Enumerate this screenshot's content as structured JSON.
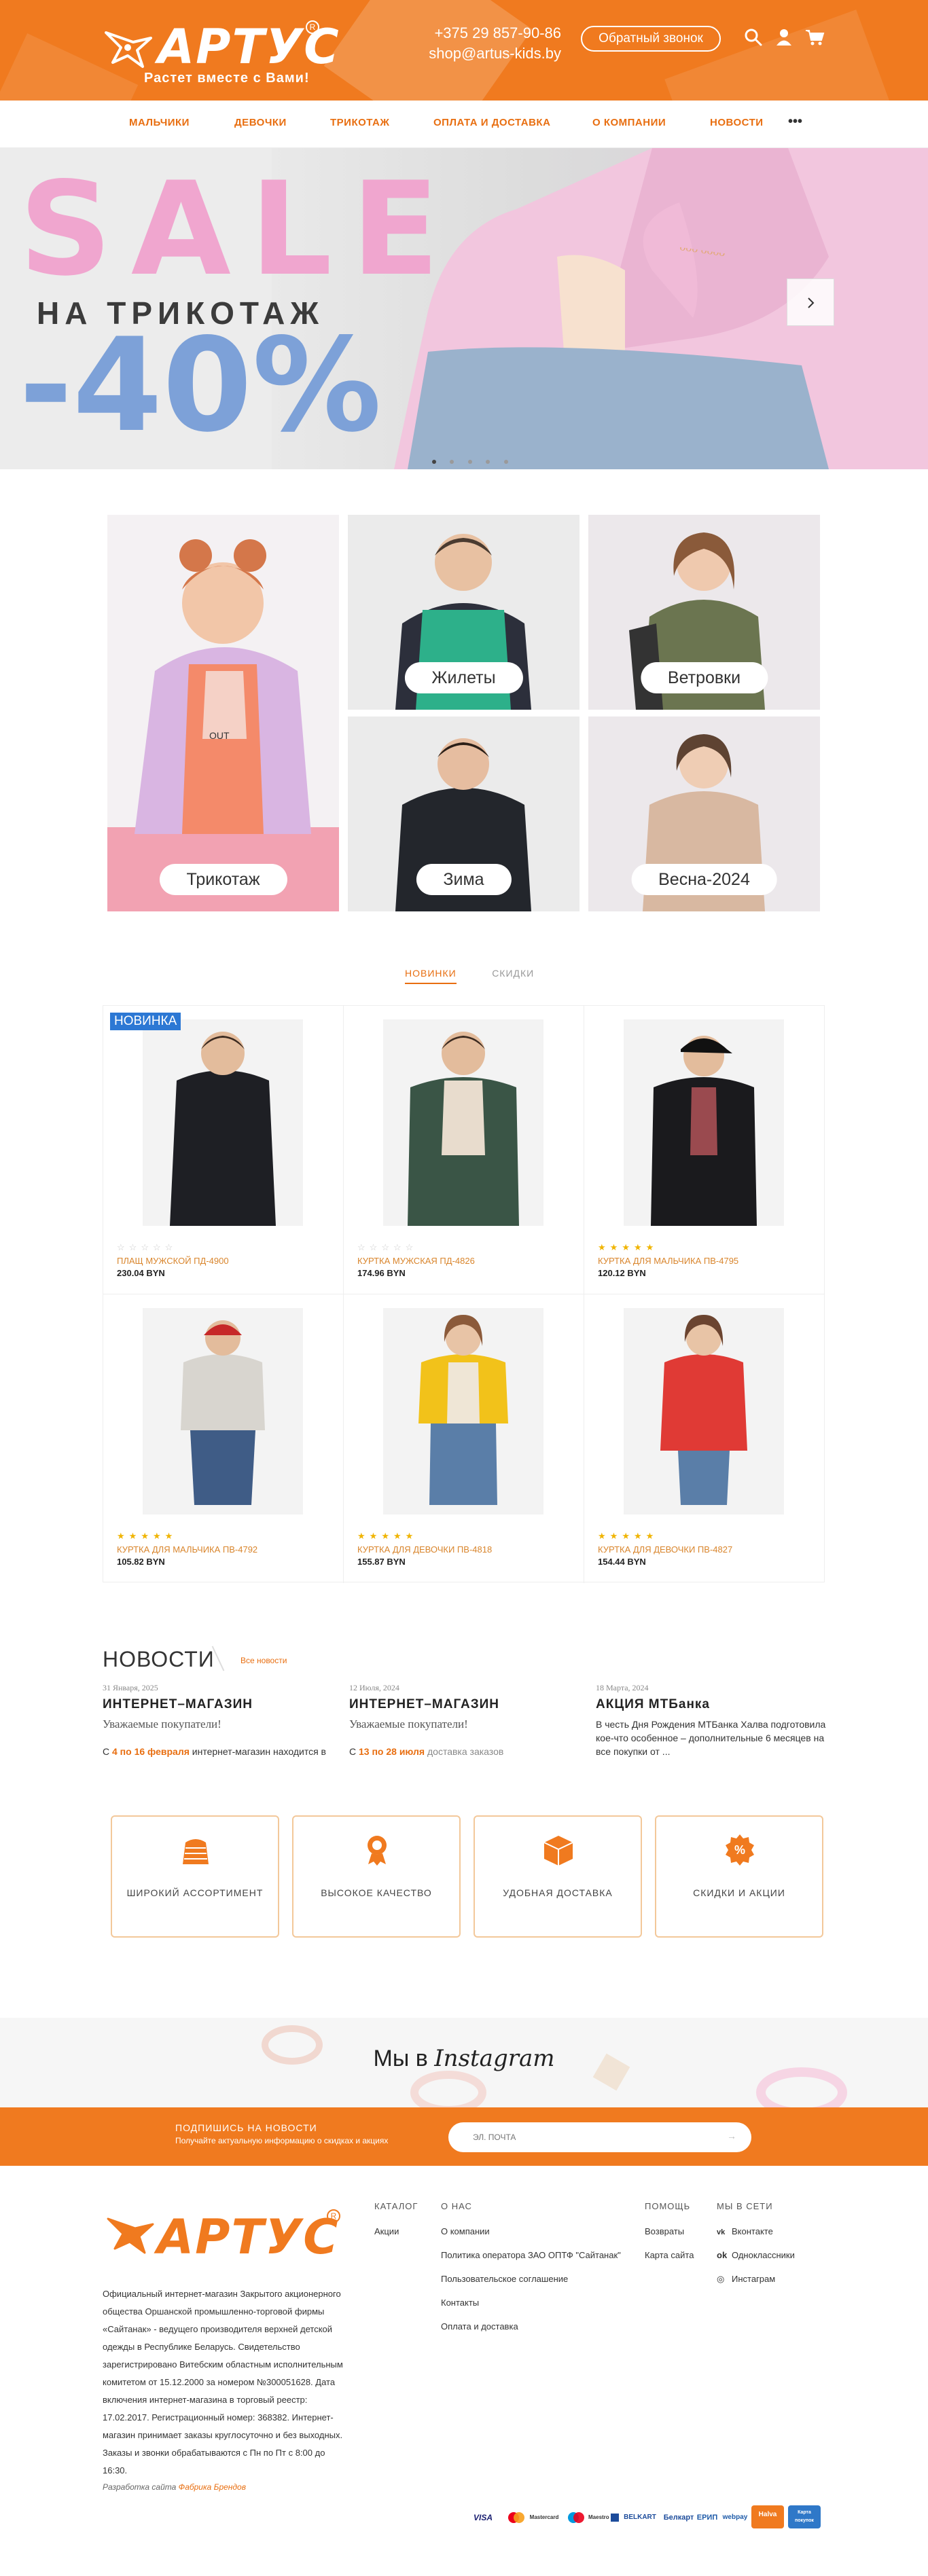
{
  "header": {
    "logo_text": "АРТУС",
    "logo_reg": "R",
    "slogan": "Растет вместе с Вами!",
    "phone": "+375 29 857-90-86",
    "email": "shop@artus-kids.by",
    "callback_label": "Обратный звонок"
  },
  "nav": {
    "items": [
      "МАЛЬЧИКИ",
      "ДЕВОЧКИ",
      "ТРИКОТАЖ",
      "ОПЛАТА И ДОСТАВКА",
      "О КОМПАНИИ",
      "НОВОСТИ"
    ],
    "more": "•••"
  },
  "hero": {
    "sale": "SALE",
    "subtitle": "НА ТРИКОТАЖ",
    "discount": "-40%",
    "slide_count": 5,
    "active_slide": 1
  },
  "categories": [
    {
      "label": "Трикотаж"
    },
    {
      "label": "Жилеты"
    },
    {
      "label": "Ветровки"
    },
    {
      "label": "Зима"
    },
    {
      "label": "Весна-2024"
    }
  ],
  "tabs": {
    "new": "НОВИНКИ",
    "sale": "СКИДКИ"
  },
  "products": [
    {
      "name": "ПЛАЩ МУЖСКОЙ ПД-4900",
      "price": "230.04 BYN",
      "badge": "НОВИНКА",
      "rating": 0
    },
    {
      "name": "КУРТКА МУЖСКАЯ ПД-4826",
      "price": "174.96 BYN",
      "badge": "",
      "rating": 0
    },
    {
      "name": "КУРТКА ДЛЯ МАЛЬЧИКА ПВ-4795",
      "price": "120.12 BYN",
      "badge": "",
      "rating": 5
    },
    {
      "name": "КУРТКА ДЛЯ МАЛЬЧИКА ПВ-4792",
      "price": "105.82 BYN",
      "badge": "",
      "rating": 5
    },
    {
      "name": "КУРТКА ДЛЯ ДЕВОЧКИ ПВ-4818",
      "price": "155.87 BYN",
      "badge": "",
      "rating": 5
    },
    {
      "name": "КУРТКА ДЛЯ ДЕВОЧКИ ПВ-4827",
      "price": "154.44 BYN",
      "badge": "",
      "rating": 5
    }
  ],
  "news": {
    "title": "НОВОСТИ",
    "all_link": "Все новости",
    "items": [
      {
        "date": "31 Января, 2025",
        "head": "ИНТЕРНЕТ–МАГАЗИН",
        "sub": "Уважаемые покупатели!",
        "pre": "С ",
        "highlight": "4 по 16 февраля",
        "post": " интернет-магазин находится в"
      },
      {
        "date": "12 Июля, 2024",
        "head": "ИНТЕРНЕТ–МАГАЗИН",
        "sub": "Уважаемые покупатели!",
        "pre": "С ",
        "highlight": "13 по 28 июля",
        "post": " доставка заказов"
      },
      {
        "date": "18 Марта, 2024",
        "head": "АКЦИЯ МТБанка",
        "sub": "",
        "pre": "В честь Дня Рождения МТБанка Халва подготовила кое-что особенное – дополнительные 6 месяцев на все покупки от ...",
        "highlight": "",
        "post": ""
      }
    ]
  },
  "features": [
    "ШИРОКИЙ АССОРТИМЕНТ",
    "ВЫСОКОЕ КАЧЕСТВО",
    "УДОБНАЯ ДОСТАВКА",
    "СКИДКИ И АКЦИИ"
  ],
  "instagram": {
    "pre": "Мы в ",
    "name": "Instagram"
  },
  "subscribe": {
    "title": "ПОДПИШИСЬ НА НОВОСТИ",
    "subtitle": "Получайте актуальную информацию о скидках и акциях",
    "placeholder": "ЭЛ. ПОЧТА",
    "arrow": "→"
  },
  "footer": {
    "description": "Официальный интернет-магазин Закрытого акционерного общества Оршанской промышленно-торговой фирмы «Сайтанак» - ведущего производителя верхней детской одежды в Республике Беларусь. Свидетельство зарегистрировано Витебским областным исполнительным комитетом от 15.12.2000 за номером №300051628. Дата включения интернет-магазина в торговый реестр: 17.02.2017. Регистрационный номер: 368382. Интернет-магазин принимает заказы круглосуточно и без выходных. Заказы и звонки обрабатываются с Пн по Пт с 8:00 до 16:30.",
    "dev_pre": "Разработка сайта ",
    "dev_name": "Фабрика Брендов",
    "catalog": {
      "title": "КАТАЛОГ",
      "links": [
        "Акции"
      ]
    },
    "about": {
      "title": "О НАС",
      "links": [
        "О компании",
        "Политика оператора ЗАО ОПТФ \"Сайтанак\"",
        "Пользовательское соглашение",
        "Контакты",
        "Оплата и доставка"
      ]
    },
    "help": {
      "title": "ПОМОЩЬ",
      "links": [
        "Возвраты",
        "Карта сайта"
      ]
    },
    "social": {
      "title": "МЫ В СЕТИ",
      "links": [
        "Вконтакте",
        "Одноклассники",
        "Инстаграм"
      ]
    },
    "payments": [
      "VISA",
      "Mastercard",
      "Maestro",
      "BELKART",
      "Белкарт",
      "ЕРИП",
      "webpay",
      "Halva",
      "Карта покупок"
    ]
  },
  "colors": {
    "brand": "#f07a1f",
    "accent": "#e86e10",
    "badge": "#2c78d4",
    "star": "#f0b400"
  }
}
